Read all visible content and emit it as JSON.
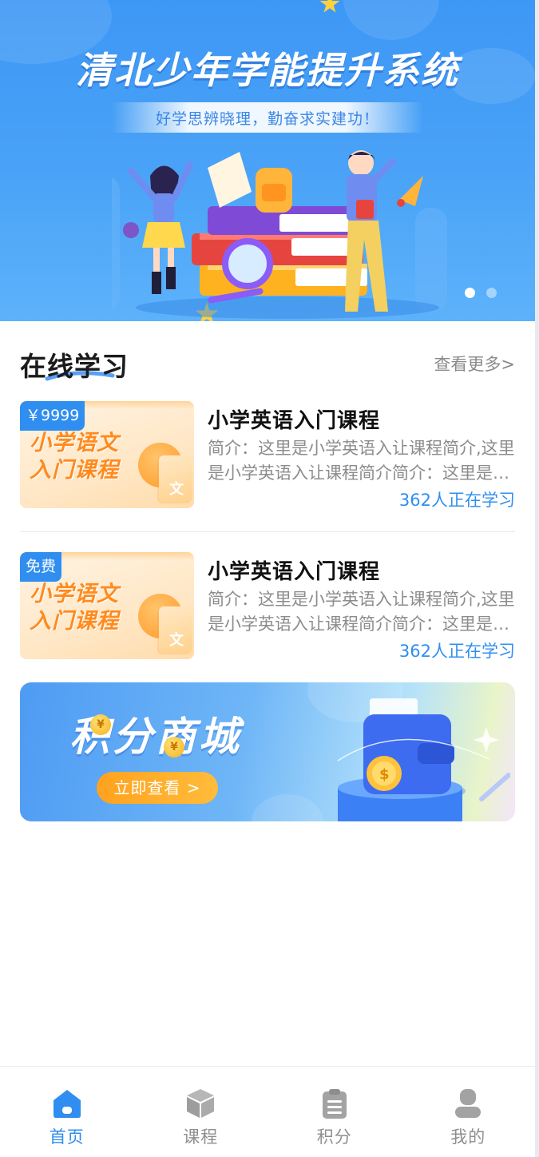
{
  "banner": {
    "title": "清北少年学能提升系统",
    "subtitle": "好学思辨晓理，勤奋求实建功！",
    "slides_total": 2,
    "active_slide": 1
  },
  "section": {
    "title": "在线学习",
    "more_link": "查看更多>"
  },
  "courses": [
    {
      "thumb_title_line1": "小学语文",
      "thumb_title_line2": "入门课程",
      "thumb_icon_char": "文",
      "price_tag": "￥9999",
      "name": "小学英语入门课程",
      "description": "简介：这里是小学英语入让课程简介,这里是小学英语入让课程简介简介：这里是小学英语入让课程简介",
      "learners": "362人正在学习"
    },
    {
      "thumb_title_line1": "小学语文",
      "thumb_title_line2": "入门课程",
      "thumb_icon_char": "文",
      "price_tag": "免费",
      "name": "小学英语入门课程",
      "description": "简介：这里是小学英语入让课程简介,这里是小学英语入让课程简介简介：这里是小学英语入让课程简介",
      "learners": "362人正在学习"
    }
  ],
  "mall": {
    "title": "积分商城",
    "coin_symbol": "¥",
    "button_label": "立即查看 >"
  },
  "tabbar": {
    "tabs": [
      {
        "label": "首页",
        "icon": "home-icon",
        "active": true
      },
      {
        "label": "课程",
        "icon": "box-icon",
        "active": false
      },
      {
        "label": "积分",
        "icon": "clipboard-icon",
        "active": false
      },
      {
        "label": "我的",
        "icon": "user-icon",
        "active": false
      }
    ]
  },
  "colors": {
    "primary": "#2f8ef0",
    "banner_blue": "#3d97f5",
    "orange": "#ff8a1e",
    "mall_button": "#ffa21f",
    "inactive": "#8f8f8f"
  }
}
